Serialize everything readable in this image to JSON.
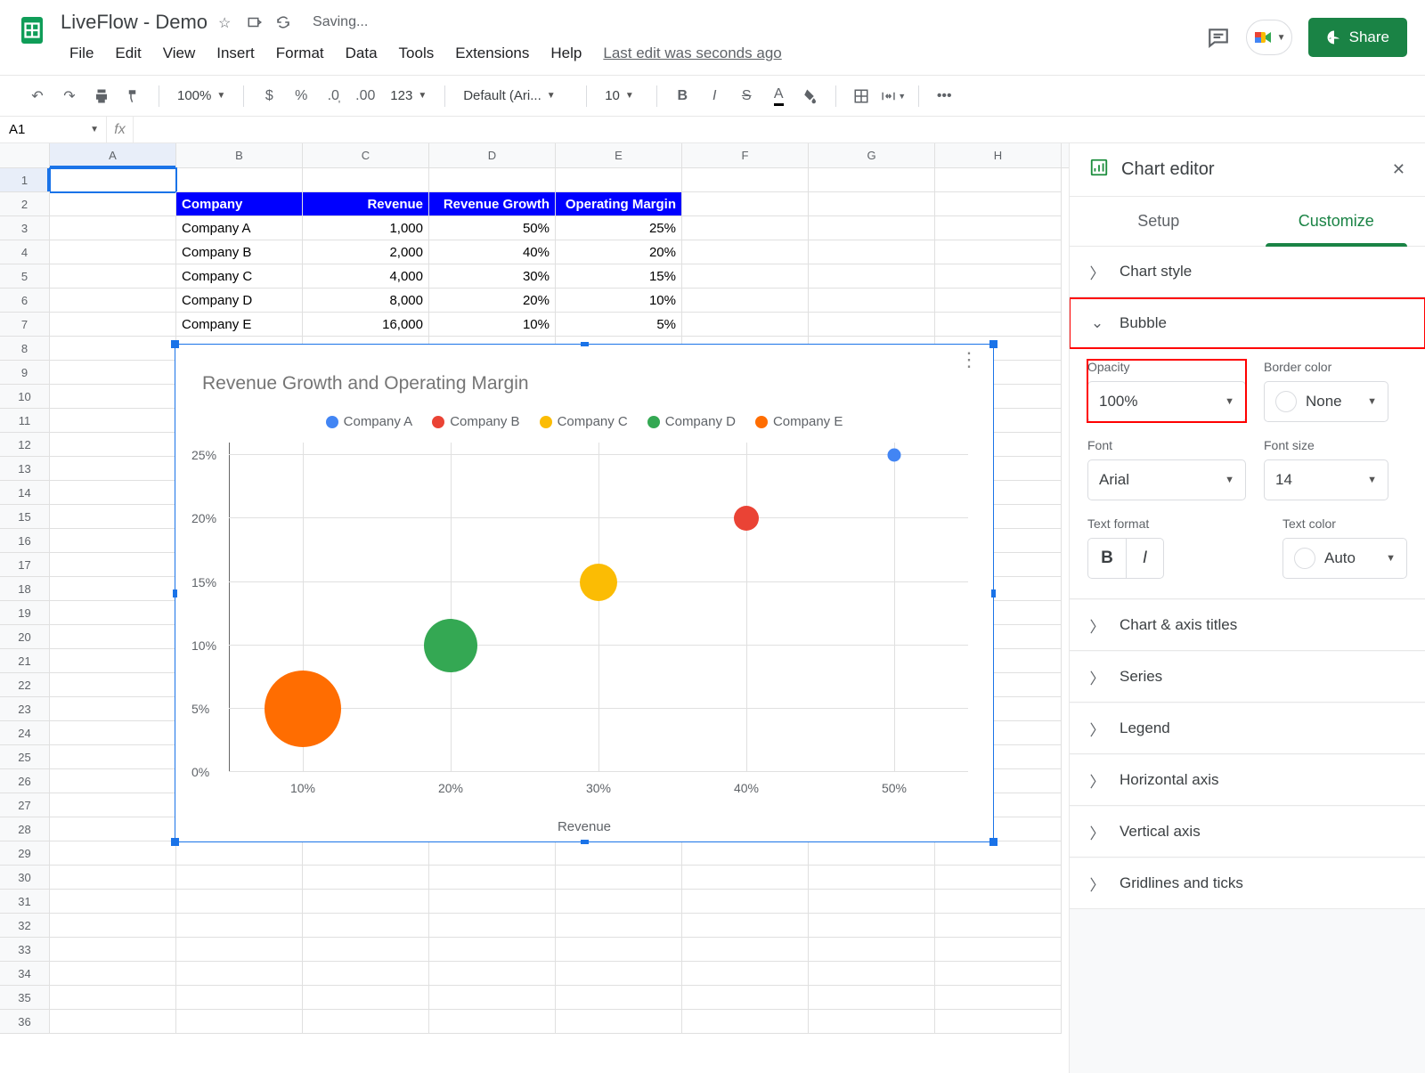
{
  "doc": {
    "title": "LiveFlow - Demo",
    "saving": "Saving...",
    "last_edit": "Last edit was seconds ago"
  },
  "menu": {
    "file": "File",
    "edit": "Edit",
    "view": "View",
    "insert": "Insert",
    "format": "Format",
    "data": "Data",
    "tools": "Tools",
    "extensions": "Extensions",
    "help": "Help"
  },
  "share": "Share",
  "toolbar": {
    "zoom": "100%",
    "font": "Default (Ari...",
    "size": "10",
    "num_fmt": "123"
  },
  "namebox": "A1",
  "sheet": {
    "cols": [
      "A",
      "B",
      "C",
      "D",
      "E",
      "F",
      "G",
      "H"
    ],
    "rows_count": 36,
    "headers": {
      "b": "Company",
      "c": "Revenue",
      "d": "Revenue Growth",
      "e": "Operating Margin"
    },
    "data": [
      {
        "b": "Company A",
        "c": "1,000",
        "d": "50%",
        "e": "25%"
      },
      {
        "b": "Company B",
        "c": "2,000",
        "d": "40%",
        "e": "20%"
      },
      {
        "b": "Company C",
        "c": "4,000",
        "d": "30%",
        "e": "15%"
      },
      {
        "b": "Company D",
        "c": "8,000",
        "d": "20%",
        "e": "10%"
      },
      {
        "b": "Company E",
        "c": "16,000",
        "d": "10%",
        "e": "5%"
      }
    ]
  },
  "chart_data": {
    "type": "scatter",
    "title": "Revenue Growth and Operating Margin",
    "xlabel": "Revenue",
    "xlim": [
      5,
      55
    ],
    "ylim": [
      0,
      26
    ],
    "xticks": [
      "10%",
      "20%",
      "30%",
      "40%",
      "50%"
    ],
    "yticks": [
      "0%",
      "5%",
      "10%",
      "15%",
      "20%",
      "25%"
    ],
    "series": [
      {
        "name": "Company A",
        "color": "#4285f4",
        "x": 50,
        "y": 25,
        "size": 15
      },
      {
        "name": "Company B",
        "color": "#ea4335",
        "x": 40,
        "y": 20,
        "size": 28
      },
      {
        "name": "Company C",
        "color": "#fbbc04",
        "x": 30,
        "y": 15,
        "size": 42
      },
      {
        "name": "Company D",
        "color": "#34a853",
        "x": 20,
        "y": 10,
        "size": 60
      },
      {
        "name": "Company E",
        "color": "#ff6d01",
        "x": 10,
        "y": 5,
        "size": 86
      }
    ]
  },
  "sidebar": {
    "title": "Chart editor",
    "tabs": {
      "setup": "Setup",
      "customize": "Customize"
    },
    "sections": {
      "chart_style": "Chart style",
      "bubble": "Bubble",
      "chart_axis_titles": "Chart & axis titles",
      "series": "Series",
      "legend": "Legend",
      "horizontal_axis": "Horizontal axis",
      "vertical_axis": "Vertical axis",
      "gridlines": "Gridlines and ticks"
    },
    "bubble": {
      "opacity_label": "Opacity",
      "opacity_value": "100%",
      "border_label": "Border color",
      "border_value": "None",
      "font_label": "Font",
      "font_value": "Arial",
      "size_label": "Font size",
      "size_value": "14",
      "tf_label": "Text format",
      "tc_label": "Text color",
      "tc_value": "Auto"
    }
  }
}
